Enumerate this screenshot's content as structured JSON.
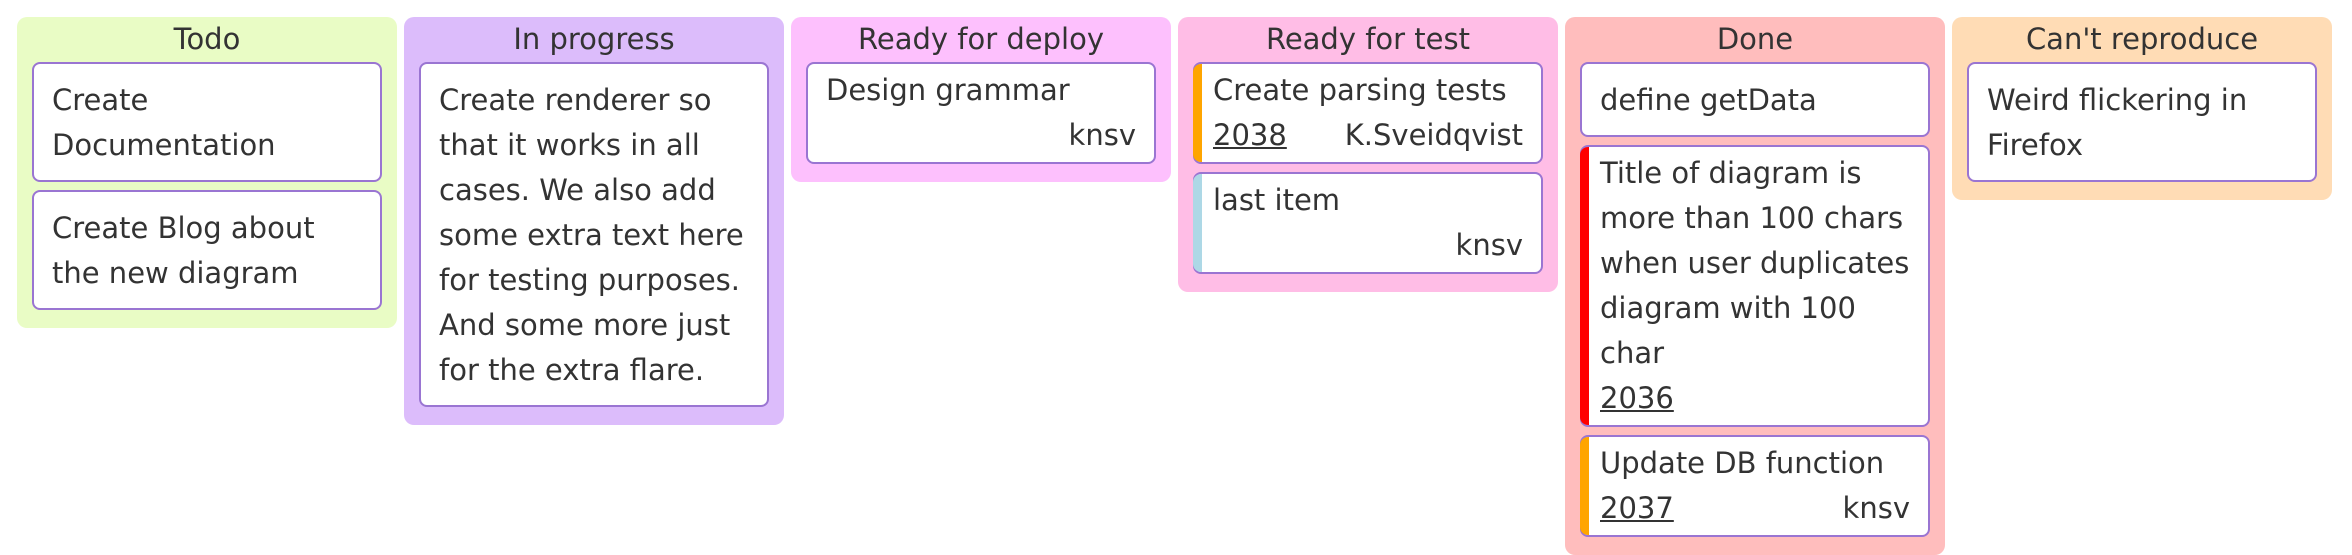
{
  "columns": [
    {
      "title": "Todo",
      "color": "#e9fcc5",
      "cards": [
        {
          "text": "Create Documentation"
        },
        {
          "text": "Create Blog about the new diagram"
        }
      ]
    },
    {
      "title": "In progress",
      "color": "#dcbcfb",
      "cards": [
        {
          "text": "Create renderer so that it works in all cases. We also add some extra text here for testing purposes. And some more just for the extra flare."
        }
      ]
    },
    {
      "title": "Ready for deploy",
      "color": "#fdc0fd",
      "cards": [
        {
          "text": "Design grammar",
          "assignee": "knsv"
        }
      ]
    },
    {
      "title": "Ready for test",
      "color": "#ffbde6",
      "cards": [
        {
          "text": "Create parsing tests",
          "ticket": "2038",
          "assignee": "K.Sveidqvist",
          "priority_color": "#ffa500"
        },
        {
          "text": "last item",
          "assignee": "knsv",
          "priority_color": "#add8e6"
        }
      ]
    },
    {
      "title": "Done",
      "color": "#ffbdbd",
      "cards": [
        {
          "text": "define getData"
        },
        {
          "text": "Title of diagram is more than 100 chars when user duplicates diagram with 100 char",
          "ticket": "2036",
          "priority_color": "#ff0000"
        },
        {
          "text": "Update DB function",
          "ticket": "2037",
          "assignee": "knsv",
          "priority_color": "#ffa500"
        }
      ]
    },
    {
      "title": "Can't reproduce",
      "color": "#ffdcb5",
      "cards": [
        {
          "text": "Weird flickering in Firefox"
        }
      ]
    }
  ]
}
